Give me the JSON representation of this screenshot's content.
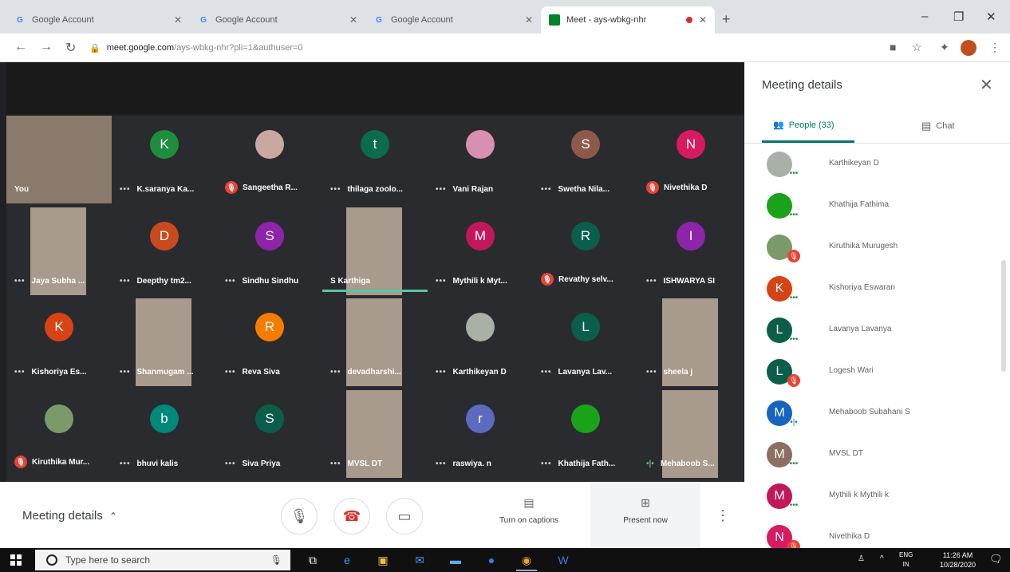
{
  "browser": {
    "tabs": [
      {
        "title": "Google Account",
        "icon": "G"
      },
      {
        "title": "Google Account",
        "icon": "G"
      },
      {
        "title": "Google Account",
        "icon": "G"
      },
      {
        "title": "Meet - ays-wbkg-nhr",
        "icon": "meet-icon"
      }
    ],
    "url_host": "meet.google.com",
    "url_path": "/ays-wbkg-nhr?pli=1&authuser=0"
  },
  "tiles": [
    {
      "name": "You",
      "type": "video",
      "status": "none"
    },
    {
      "name": "K.saranya Ka...",
      "type": "avatar",
      "letter": "K",
      "color": "#1e8e3e",
      "status": "dots"
    },
    {
      "name": "Sangeetha R...",
      "type": "photo",
      "color": "#c9a8a0",
      "status": "muted"
    },
    {
      "name": "thilaga zoolo...",
      "type": "avatar",
      "letter": "t",
      "color": "#0b6b4f",
      "status": "dots"
    },
    {
      "name": "Vani Rajan",
      "type": "photo",
      "color": "#d98fb0",
      "status": "dots"
    },
    {
      "name": "Swetha Nila...",
      "type": "avatar",
      "letter": "S",
      "color": "#8d5a4a",
      "status": "dots"
    },
    {
      "name": "Nivethika D",
      "type": "avatar",
      "letter": "N",
      "color": "#d81b60",
      "status": "muted"
    },
    {
      "name": "Jaya Subha ...",
      "type": "video",
      "status": "dots"
    },
    {
      "name": "Deepthy tm2...",
      "type": "avatar",
      "letter": "D",
      "color": "#c94a1e",
      "status": "dots"
    },
    {
      "name": "Sindhu Sindhu",
      "type": "avatar",
      "letter": "S",
      "color": "#8e24aa",
      "status": "dots"
    },
    {
      "name": "S Karthiga",
      "type": "video",
      "status": "none"
    },
    {
      "name": "Mythili k Myt...",
      "type": "avatar",
      "letter": "M",
      "color": "#c2185b",
      "status": "dots"
    },
    {
      "name": "Revathy selv...",
      "type": "avatar",
      "letter": "R",
      "color": "#0b5e4a",
      "status": "muted"
    },
    {
      "name": "ISHWARYA SI",
      "type": "avatar",
      "letter": "I",
      "color": "#8e24aa",
      "status": "dots"
    },
    {
      "name": "Kishoriya Es...",
      "type": "avatar",
      "letter": "K",
      "color": "#d84315",
      "status": "dots"
    },
    {
      "name": "Shanmugam ...",
      "type": "video",
      "status": "dots"
    },
    {
      "name": "Reva Siva",
      "type": "avatar",
      "letter": "R",
      "color": "#f57c00",
      "status": "dots"
    },
    {
      "name": "devadharshi...",
      "type": "video",
      "status": "dots"
    },
    {
      "name": "Karthikeyan D",
      "type": "photo",
      "color": "#a8b0a8",
      "status": "dots"
    },
    {
      "name": "Lavanya Lav...",
      "type": "avatar",
      "letter": "L",
      "color": "#0b5e4a",
      "status": "dots"
    },
    {
      "name": "sheela j",
      "type": "video",
      "status": "dots"
    },
    {
      "name": "Kiruthika Mur...",
      "type": "photo",
      "color": "#7a9a6a",
      "status": "muted"
    },
    {
      "name": "bhuvi kalis",
      "type": "avatar",
      "letter": "b",
      "color": "#00897b",
      "status": "dots"
    },
    {
      "name": "Siva Priya",
      "type": "avatar",
      "letter": "S",
      "color": "#0b5e4a",
      "status": "dots"
    },
    {
      "name": "MVSL DT",
      "type": "video",
      "status": "dots"
    },
    {
      "name": "raswiya. n",
      "type": "avatar",
      "letter": "r",
      "color": "#5c6bc0",
      "status": "dots"
    },
    {
      "name": "Khathija Fath...",
      "type": "photo",
      "color": "#1aa31a",
      "status": "dots"
    },
    {
      "name": "Mehaboob S...",
      "type": "video",
      "status": "speaking"
    }
  ],
  "controls": {
    "meeting_details": "Meeting details",
    "captions": "Turn on captions",
    "present": "Present now"
  },
  "panel": {
    "title": "Meeting details",
    "people_tab": "People (33)",
    "chat_tab": "Chat",
    "people": [
      {
        "name": "Karthikeyan D",
        "letter": "",
        "color": "#a8b0a8",
        "badge": "dots"
      },
      {
        "name": "Khathija Fathima",
        "letter": "",
        "color": "#1aa31a",
        "badge": "dots"
      },
      {
        "name": "Kiruthika Murugesh",
        "letter": "",
        "color": "#7a9a6a",
        "badge": "off"
      },
      {
        "name": "Kishoriya Eswaran",
        "letter": "K",
        "color": "#d84315",
        "badge": "dots"
      },
      {
        "name": "Lavanya Lavanya",
        "letter": "L",
        "color": "#0b5e4a",
        "badge": "dots"
      },
      {
        "name": "Logesh Wari",
        "letter": "L",
        "color": "#0b5e4a",
        "badge": "off"
      },
      {
        "name": "Mehaboob Subahani S",
        "letter": "M",
        "color": "#1565c0",
        "badge": "speak"
      },
      {
        "name": "MVSL DT",
        "letter": "M",
        "color": "#8d6e63",
        "badge": "dots"
      },
      {
        "name": "Mythili k Mythili k",
        "letter": "M",
        "color": "#c2185b",
        "badge": "dots"
      },
      {
        "name": "Nivethika D",
        "letter": "N",
        "color": "#d81b60",
        "badge": "off"
      }
    ]
  },
  "taskbar": {
    "search_placeholder": "Type here to search",
    "lang_line1": "ENG",
    "lang_line2": "IN",
    "time": "11:26 AM",
    "date": "10/28/2020"
  }
}
